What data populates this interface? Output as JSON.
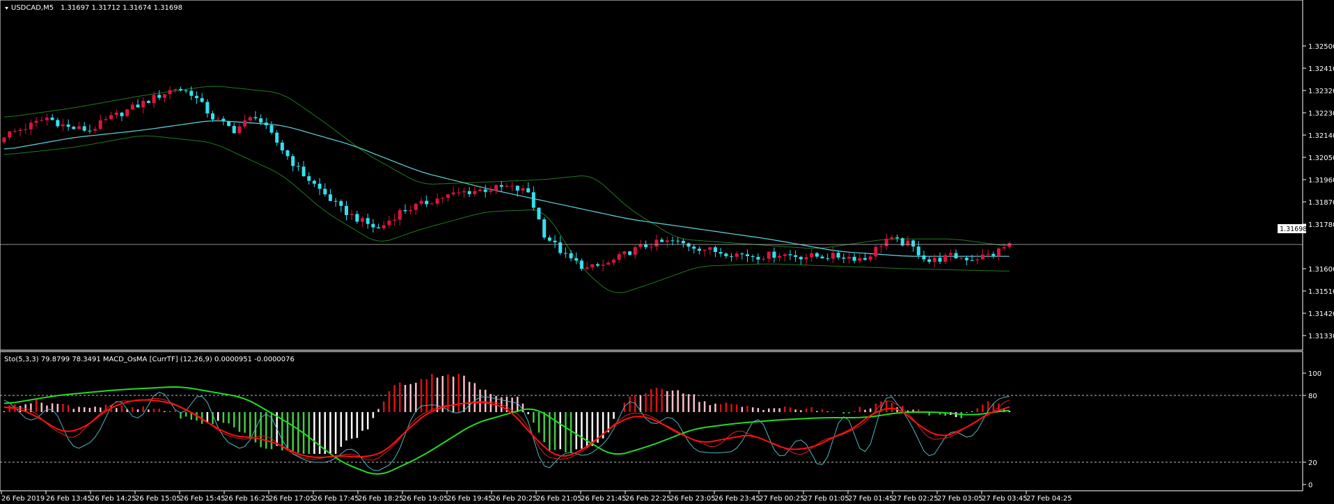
{
  "main_header": {
    "symbol": "USDCAD,M5",
    "ohlc": "1.31697 1.31712 1.31674 1.31698"
  },
  "sub_header": {
    "indicators": "Sto(5,3,3) 79.8799 78.3491  MACD_OsMA [CurrTF] (12,26,9) 0.0000951 -0.0000076"
  },
  "colors": {
    "background": "#000000",
    "bull_candle": "#dc143c",
    "bear_candle": "#33e0f0",
    "bollinger": "#1f7a1f",
    "ma": "#5fd8e0",
    "stoch_k": "#4fb8c0",
    "stoch_d": "#e02020",
    "slow_green": "#22dd22",
    "slow_red": "#ff1111",
    "hist_red": "#dd1111",
    "hist_pink": "#ffc0cb",
    "hist_green": "#44cc44",
    "hist_white": "#ffffff",
    "grid_line": "#c0c0c0"
  },
  "chart_data": [
    {
      "type": "candlestick",
      "title": "USDCAD,M5",
      "ylim": [
        1.3133,
        1.3259
      ],
      "y_ticks": [
        "1.32500",
        "1.32410",
        "1.32320",
        "1.32230",
        "1.32140",
        "1.32050",
        "1.31960",
        "1.31870",
        "1.31780",
        "1.31690",
        "1.31600",
        "1.31510",
        "1.31420",
        "1.31330"
      ],
      "current_price": "1.31698",
      "current_price_value": 1.31698,
      "close_series": [
        [
          0,
          1.3214
        ],
        [
          4,
          1.3217
        ],
        [
          8,
          1.3221
        ],
        [
          12,
          1.3217
        ],
        [
          16,
          1.3216
        ],
        [
          20,
          1.3221
        ],
        [
          24,
          1.3225
        ],
        [
          28,
          1.3229
        ],
        [
          32,
          1.3233
        ],
        [
          35,
          1.3231
        ],
        [
          39,
          1.3221
        ],
        [
          43,
          1.3216
        ],
        [
          47,
          1.3222
        ],
        [
          51,
          1.3211
        ],
        [
          55,
          1.32
        ],
        [
          59,
          1.3192
        ],
        [
          63,
          1.3184
        ],
        [
          67,
          1.3179
        ],
        [
          70,
          1.3176
        ],
        [
          74,
          1.3183
        ],
        [
          78,
          1.3186
        ],
        [
          82,
          1.3189
        ],
        [
          86,
          1.3191
        ],
        [
          90,
          1.3192
        ],
        [
          94,
          1.3193
        ],
        [
          98,
          1.3191
        ],
        [
          101,
          1.3174
        ],
        [
          105,
          1.3165
        ],
        [
          109,
          1.316
        ],
        [
          113,
          1.3162
        ],
        [
          117,
          1.3167
        ],
        [
          121,
          1.317
        ],
        [
          125,
          1.3171
        ],
        [
          129,
          1.3169
        ],
        [
          133,
          1.3167
        ],
        [
          137,
          1.3166
        ],
        [
          141,
          1.3165
        ],
        [
          145,
          1.3166
        ],
        [
          149,
          1.3165
        ],
        [
          153,
          1.3165
        ],
        [
          157,
          1.3165
        ],
        [
          161,
          1.3164
        ],
        [
          165,
          1.3172
        ],
        [
          169,
          1.317
        ],
        [
          173,
          1.3163
        ],
        [
          177,
          1.3165
        ],
        [
          181,
          1.3164
        ],
        [
          185,
          1.3166
        ],
        [
          188,
          1.317
        ]
      ],
      "ma_series": [
        [
          0,
          1.3208
        ],
        [
          13,
          1.3213
        ],
        [
          26,
          1.3216
        ],
        [
          39,
          1.322
        ],
        [
          52,
          1.3218
        ],
        [
          65,
          1.321
        ],
        [
          78,
          1.3199
        ],
        [
          91,
          1.3192
        ],
        [
          104,
          1.3186
        ],
        [
          117,
          1.318
        ],
        [
          130,
          1.3176
        ],
        [
          143,
          1.3172
        ],
        [
          156,
          1.3167
        ],
        [
          169,
          1.3165
        ],
        [
          182,
          1.3165
        ],
        [
          188,
          1.3165
        ]
      ],
      "bollinger_upper": [
        [
          0,
          1.3221
        ],
        [
          13,
          1.3225
        ],
        [
          26,
          1.323
        ],
        [
          39,
          1.3234
        ],
        [
          52,
          1.3231
        ],
        [
          60,
          1.3219
        ],
        [
          68,
          1.3206
        ],
        [
          78,
          1.3194
        ],
        [
          90,
          1.3195
        ],
        [
          101,
          1.3196
        ],
        [
          110,
          1.3198
        ],
        [
          117,
          1.3184
        ],
        [
          126,
          1.3172
        ],
        [
          139,
          1.317
        ],
        [
          152,
          1.3168
        ],
        [
          165,
          1.3172
        ],
        [
          178,
          1.3172
        ],
        [
          188,
          1.3169
        ]
      ],
      "bollinger_lower": [
        [
          0,
          1.3206
        ],
        [
          13,
          1.3209
        ],
        [
          26,
          1.3214
        ],
        [
          39,
          1.3211
        ],
        [
          52,
          1.3198
        ],
        [
          60,
          1.3183
        ],
        [
          70,
          1.317
        ],
        [
          78,
          1.3176
        ],
        [
          90,
          1.3183
        ],
        [
          101,
          1.3184
        ],
        [
          108,
          1.316
        ],
        [
          114,
          1.3149
        ],
        [
          121,
          1.3154
        ],
        [
          130,
          1.3161
        ],
        [
          143,
          1.3162
        ],
        [
          156,
          1.3161
        ],
        [
          169,
          1.316
        ],
        [
          188,
          1.3159
        ]
      ]
    },
    {
      "type": "line",
      "title": "Sto(5,3,3) 79.8799 78.3491  MACD_OsMA [CurrTF] (12,26,9) 0.0000951 -0.0000076",
      "ylim": [
        0,
        100
      ],
      "y_ticks": [
        "100",
        "80",
        "20",
        "0"
      ],
      "levels": [
        80,
        20
      ],
      "x_ticks": [
        "26 Feb 2019",
        "26 Feb 13:45",
        "26 Feb 14:25",
        "26 Feb 15:05",
        "26 Feb 15:45",
        "26 Feb 16:25",
        "26 Feb 17:05",
        "26 Feb 17:45",
        "26 Feb 18:25",
        "26 Feb 19:05",
        "26 Feb 19:45",
        "26 Feb 20:25",
        "26 Feb 21:05",
        "26 Feb 21:45",
        "26 Feb 22:25",
        "26 Feb 23:05",
        "26 Feb 23:45",
        "27 Feb 00:25",
        "27 Feb 01:05",
        "27 Feb 01:45",
        "27 Feb 02:25",
        "27 Feb 03:05",
        "27 Feb 03:45",
        "27 Feb 04:25"
      ],
      "stoch_k": [
        [
          0,
          78
        ],
        [
          5,
          55
        ],
        [
          9,
          72
        ],
        [
          13,
          30
        ],
        [
          17,
          40
        ],
        [
          21,
          80
        ],
        [
          25,
          55
        ],
        [
          29,
          88
        ],
        [
          33,
          60
        ],
        [
          37,
          85
        ],
        [
          41,
          40
        ],
        [
          45,
          30
        ],
        [
          49,
          70
        ],
        [
          53,
          30
        ],
        [
          57,
          20
        ],
        [
          61,
          20
        ],
        [
          65,
          35
        ],
        [
          69,
          10
        ],
        [
          73,
          20
        ],
        [
          77,
          70
        ],
        [
          81,
          72
        ],
        [
          85,
          62
        ],
        [
          89,
          80
        ],
        [
          93,
          76
        ],
        [
          97,
          72
        ],
        [
          101,
          10
        ],
        [
          105,
          30
        ],
        [
          109,
          25
        ],
        [
          113,
          40
        ],
        [
          117,
          80
        ],
        [
          121,
          52
        ],
        [
          125,
          63
        ],
        [
          129,
          30
        ],
        [
          133,
          28
        ],
        [
          137,
          30
        ],
        [
          141,
          65
        ],
        [
          145,
          20
        ],
        [
          149,
          45
        ],
        [
          153,
          10
        ],
        [
          157,
          70
        ],
        [
          161,
          20
        ],
        [
          165,
          85
        ],
        [
          169,
          60
        ],
        [
          173,
          20
        ],
        [
          177,
          50
        ],
        [
          181,
          40
        ],
        [
          185,
          75
        ],
        [
          188,
          80
        ]
      ],
      "stoch_d": [
        [
          0,
          70
        ],
        [
          5,
          68
        ],
        [
          9,
          50
        ],
        [
          13,
          40
        ],
        [
          17,
          60
        ],
        [
          21,
          75
        ],
        [
          25,
          75
        ],
        [
          29,
          78
        ],
        [
          33,
          70
        ],
        [
          37,
          60
        ],
        [
          41,
          45
        ],
        [
          45,
          40
        ],
        [
          49,
          45
        ],
        [
          53,
          30
        ],
        [
          57,
          22
        ],
        [
          61,
          25
        ],
        [
          65,
          28
        ],
        [
          69,
          20
        ],
        [
          73,
          35
        ],
        [
          77,
          60
        ],
        [
          81,
          70
        ],
        [
          85,
          72
        ],
        [
          89,
          75
        ],
        [
          93,
          73
        ],
        [
          97,
          60
        ],
        [
          101,
          25
        ],
        [
          105,
          22
        ],
        [
          109,
          32
        ],
        [
          113,
          50
        ],
        [
          117,
          65
        ],
        [
          121,
          62
        ],
        [
          125,
          48
        ],
        [
          129,
          40
        ],
        [
          133,
          32
        ],
        [
          137,
          50
        ],
        [
          141,
          42
        ],
        [
          145,
          35
        ],
        [
          149,
          25
        ],
        [
          153,
          40
        ],
        [
          157,
          45
        ],
        [
          161,
          55
        ],
        [
          165,
          78
        ],
        [
          169,
          65
        ],
        [
          173,
          40
        ],
        [
          177,
          42
        ],
        [
          181,
          55
        ],
        [
          185,
          65
        ],
        [
          188,
          78
        ]
      ],
      "slow_line": [
        [
          0,
          72
        ],
        [
          10,
          80
        ],
        [
          21,
          85
        ],
        [
          33,
          88
        ],
        [
          45,
          78
        ],
        [
          55,
          50
        ],
        [
          63,
          20
        ],
        [
          70,
          7
        ],
        [
          78,
          25
        ],
        [
          88,
          55
        ],
        [
          99,
          70
        ],
        [
          107,
          45
        ],
        [
          114,
          25
        ],
        [
          121,
          35
        ],
        [
          129,
          50
        ],
        [
          137,
          55
        ],
        [
          145,
          58
        ],
        [
          153,
          60
        ],
        [
          161,
          60
        ],
        [
          168,
          65
        ],
        [
          175,
          65
        ],
        [
          181,
          62
        ],
        [
          188,
          67
        ]
      ]
    }
  ]
}
